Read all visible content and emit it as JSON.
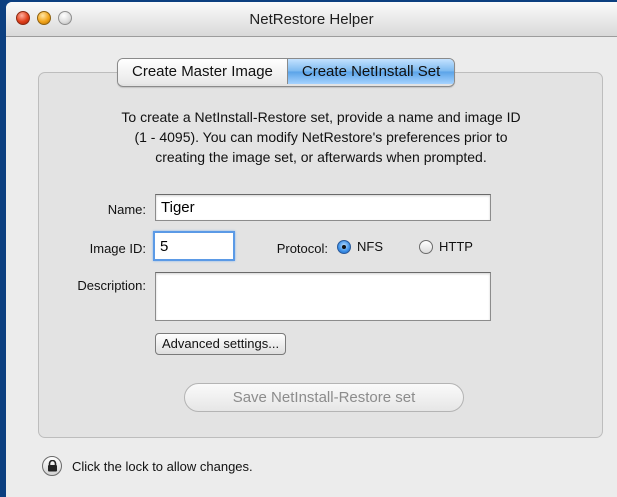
{
  "window": {
    "title": "NetRestore Helper"
  },
  "tabs": [
    {
      "label": "Create Master Image",
      "active": false
    },
    {
      "label": "Create NetInstall Set",
      "active": true
    }
  ],
  "instructions": {
    "line1": "To create a NetInstall-Restore set, provide a name and image ID",
    "line2": "(1 - 4095). You can modify NetRestore's preferences prior to",
    "line3": "creating the image set, or afterwards when prompted."
  },
  "form": {
    "name_label": "Name:",
    "name_value": "Tiger",
    "image_id_label": "Image ID:",
    "image_id_value": "5",
    "protocol_label": "Protocol:",
    "protocol_options": [
      {
        "label": "NFS",
        "selected": true
      },
      {
        "label": "HTTP",
        "selected": false
      }
    ],
    "description_label": "Description:",
    "description_value": ""
  },
  "buttons": {
    "advanced_settings": "Advanced settings...",
    "save": "Save NetInstall-Restore set"
  },
  "footer": {
    "lock_text": "Click the lock to allow changes."
  }
}
